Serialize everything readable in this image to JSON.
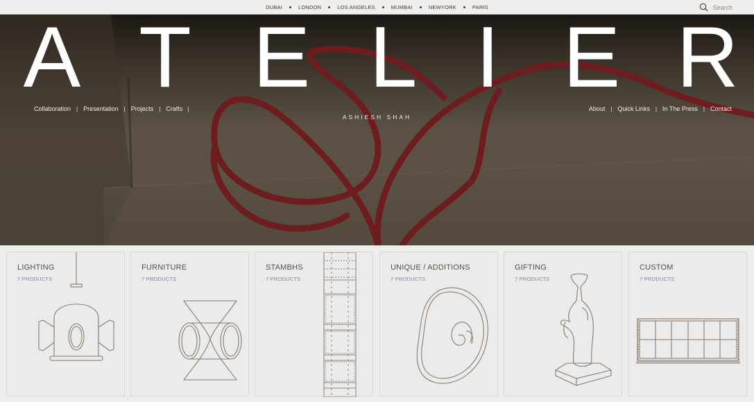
{
  "topbar": {
    "cities": [
      "DUBAI",
      "LONDON",
      "LOS ANGELES",
      "MUMBAI",
      "NEWYORK",
      "PARIS"
    ],
    "search_label": "Search"
  },
  "hero": {
    "wordmark": [
      "A",
      "T",
      "E",
      "L",
      "I",
      "E",
      "R"
    ],
    "subtitle": "ASHIESH SHAH",
    "nav_left": [
      "Collaboration",
      "Presentation",
      "Projects",
      "Crafts"
    ],
    "nav_right": [
      "About",
      "Quick Links",
      "In The Press",
      "Contact"
    ]
  },
  "categories": [
    {
      "title": "LIGHTING",
      "count": "7 PRODUCTS",
      "icon": "pendant-lamp-icon"
    },
    {
      "title": "FURNITURE",
      "count": "7 PRODUCTS",
      "icon": "stool-icon"
    },
    {
      "title": "STAMBHS",
      "count": "7 PRODUCTS",
      "icon": "pillar-icon"
    },
    {
      "title": "UNIQUE / ADDITIONS",
      "count": "7 PRODUCTS",
      "icon": "spiral-sculpture-icon"
    },
    {
      "title": "GIFTING",
      "count": "7 PRODUCTS",
      "icon": "hand-sculpture-icon"
    },
    {
      "title": "CUSTOM",
      "count": "7 PRODUCTS",
      "icon": "shelf-icon"
    }
  ],
  "colors": {
    "topbar_bg": "#f1efed",
    "card_bg": "#ebebeb",
    "card_title": "#5a4e42",
    "card_count": "#7d8596",
    "bead": "#6e1d1f"
  }
}
